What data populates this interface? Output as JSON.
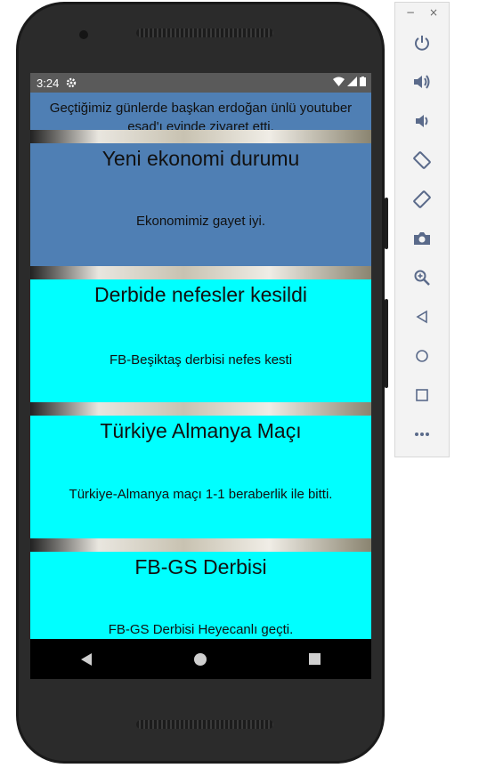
{
  "status_bar": {
    "time": "3:24"
  },
  "header": {
    "text": "Geçtiğimiz günlerde başkan erdoğan ünlü youtuber esad'ı evinde ziyaret etti."
  },
  "cards": [
    {
      "title": "Yeni ekonomi durumu",
      "body": "Ekonomimiz gayet iyi.",
      "bg": "#4f7fb4"
    },
    {
      "title": "Derbide nefesler kesildi",
      "body": "FB-Beşiktaş derbisi nefes kesti",
      "bg": "#00ffff"
    },
    {
      "title": "Türkiye Almanya Maçı",
      "body": "Türkiye-Almanya maçı 1-1 beraberlik ile bitti.",
      "bg": "#00ffff"
    },
    {
      "title": "FB-GS Derbisi",
      "body": "FB-GS Derbisi Heyecanlı geçti.",
      "bg": "#00ffff"
    }
  ],
  "emulator_panel": {
    "minimize": "−",
    "close": "×",
    "buttons": [
      "power-icon",
      "volume-up-icon",
      "volume-down-icon",
      "rotate-left-icon",
      "rotate-right-icon",
      "camera-icon",
      "zoom-icon",
      "back-icon",
      "home-icon",
      "overview-icon",
      "more-icon"
    ]
  }
}
